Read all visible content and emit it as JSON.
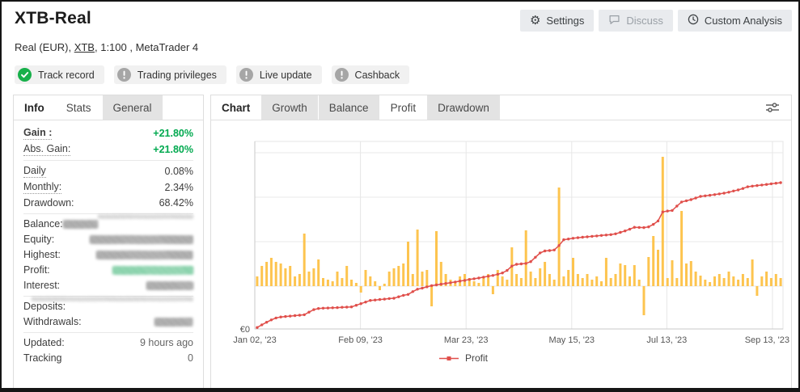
{
  "header": {
    "title": "XTB-Real",
    "subtitle": {
      "prefix": "Real (EUR), ",
      "link": "XTB",
      "suffix": ", 1:100 , MetaTrader 4"
    },
    "buttons": [
      {
        "label": "Settings",
        "icon": "gear-icon",
        "disabled": false
      },
      {
        "label": "Discuss",
        "icon": "speech-bubble-icon",
        "disabled": true
      },
      {
        "label": "Custom Analysis",
        "icon": "clock-icon",
        "disabled": false
      }
    ]
  },
  "badges": [
    {
      "label": "Track record",
      "status": "verified",
      "icon": "check-icon"
    },
    {
      "label": "Trading privileges",
      "status": "unverified",
      "icon": "exclamation-icon"
    },
    {
      "label": "Live update",
      "status": "unverified",
      "icon": "exclamation-icon"
    },
    {
      "label": "Cashback",
      "status": "unverified",
      "icon": "exclamation-icon"
    }
  ],
  "colors": {
    "accent_green": "#00a94f",
    "badge_green": "#17b04a",
    "badge_gray": "#a6a6a6",
    "bar_yellow": "#fdc44f",
    "line_red": "#e04f4b"
  },
  "stats_panel": {
    "title_tab": "Info",
    "tabs": [
      {
        "label": "Stats",
        "active": true
      },
      {
        "label": "General",
        "active": false
      }
    ],
    "groups": [
      {
        "rows": [
          {
            "label": "Gain :",
            "value": "+21.80%",
            "value_style": "green",
            "label_style": "bold dotted"
          },
          {
            "label": "Abs. Gain:",
            "value": "+21.80%",
            "value_style": "green",
            "label_style": "dotted"
          }
        ]
      },
      {
        "rows": [
          {
            "label": "Daily",
            "value": "0.08%",
            "label_style": "dotted"
          },
          {
            "label": "Monthly:",
            "value": "2.34%",
            "label_style": "dotted"
          },
          {
            "label": "Drawdown:",
            "value": "68.42%"
          }
        ]
      },
      {
        "ghost_width": 118,
        "rows": [
          {
            "label": "Balance:",
            "hidden_value": true,
            "noise_width": 92
          },
          {
            "label": "Equity:",
            "hidden_value": true,
            "noise_width": 128
          },
          {
            "label": "Highest:",
            "hidden_value": true,
            "noise_width": 120
          },
          {
            "label": "Profit:",
            "hidden_value": true,
            "noise_width": 100,
            "noise_color": "green"
          },
          {
            "label": "Interest:",
            "hidden_value": true,
            "noise_width": 58
          }
        ]
      },
      {
        "ghost_width": 200,
        "rows": [
          {
            "label": "Deposits:",
            "hidden_value": true,
            "noise_width": 78
          },
          {
            "label": "Withdrawals:",
            "hidden_value": true,
            "noise_width": 48
          }
        ]
      },
      {
        "rows": [
          {
            "label": "Updated:",
            "value": "9 hours ago",
            "value_style": "muted"
          },
          {
            "label": "Tracking",
            "value": "0",
            "value_style": "muted"
          }
        ]
      }
    ]
  },
  "chart_panel": {
    "title_tab": "Chart",
    "tabs": [
      {
        "label": "Growth",
        "active": false
      },
      {
        "label": "Balance",
        "active": false
      },
      {
        "label": "Profit",
        "active": true
      },
      {
        "label": "Drawdown",
        "active": false
      }
    ]
  },
  "chart_data": {
    "type": "bar+line",
    "title": "Profit",
    "x_axis": {
      "ticks": [
        "Jan 02, '23",
        "Feb 09, '23",
        "Mar 23, '23",
        "May 15, '23",
        "Jul 13, '23",
        "Sep 13, '23"
      ],
      "tick_fractions": [
        0,
        0.2,
        0.4,
        0.6,
        0.78,
        0.98
      ]
    },
    "y_axis": {
      "zero_label": "€0",
      "scale": "relative 0-100 (axis values hidden)",
      "gridlines": 4
    },
    "legend": [
      {
        "label": "Profit",
        "color": "#e04f4b"
      }
    ],
    "legend_position": "bottom-center",
    "series": [
      {
        "name": "Profit",
        "type": "line",
        "color": "#e04f4b",
        "values": [
          1,
          2.8,
          4.6,
          6.2,
          7.5,
          8.2,
          8.5,
          8.8,
          9.1,
          9.4,
          9.7,
          11.5,
          13.2,
          14,
          14.2,
          14.3,
          14.5,
          14.6,
          14.8,
          14.9,
          15.1,
          16.2,
          17.3,
          18.4,
          19.5,
          19.8,
          20.1,
          20.4,
          20.8,
          21,
          22,
          23,
          23.6,
          25.5,
          27.2,
          27.9,
          28.8,
          29.6,
          30.1,
          30.6,
          31.1,
          31.6,
          32.1,
          32.7,
          33.2,
          33.8,
          34.3,
          34.8,
          35.4,
          36,
          36.6,
          37.4,
          38.3,
          40,
          43,
          44.2,
          44.5,
          44.8,
          46,
          49,
          52,
          53.3,
          53.6,
          54,
          57,
          61,
          61.5,
          62,
          62.4,
          62.7,
          63,
          63.3,
          63.6,
          63.9,
          64.2,
          64.5,
          65,
          66,
          67,
          68.2,
          69.5,
          69.4,
          69.3,
          69.8,
          71.5,
          73.8,
          80,
          80.6,
          81,
          84,
          86.8,
          87.6,
          88.4,
          89.5,
          90.6,
          91,
          91.4,
          91.8,
          92.3,
          92.8,
          93.5,
          94.3,
          95,
          96,
          97.2,
          97.6,
          98,
          98.4,
          98.8,
          99.2,
          99.6,
          100
        ]
      },
      {
        "name": "Periodic profit (bars, unlabeled)",
        "type": "bar",
        "color": "#fdc44f",
        "values": [
          12,
          25,
          30,
          35,
          30,
          28,
          22,
          25,
          12,
          15,
          65,
          18,
          22,
          33,
          10,
          8,
          6,
          18,
          10,
          25,
          8,
          4,
          -8,
          20,
          12,
          6,
          -5,
          3,
          18,
          22,
          25,
          28,
          55,
          15,
          70,
          18,
          20,
          -25,
          68,
          30,
          15,
          8,
          5,
          12,
          15,
          10,
          6,
          4,
          10,
          15,
          -10,
          20,
          12,
          8,
          48,
          15,
          10,
          69,
          18,
          10,
          22,
          30,
          15,
          8,
          122,
          12,
          20,
          35,
          15,
          10,
          15,
          8,
          12,
          6,
          35,
          10,
          15,
          28,
          26,
          12,
          26,
          8,
          -36,
          36,
          62,
          45,
          160,
          10,
          32,
          10,
          93,
          28,
          31,
          18,
          13,
          8,
          5,
          12,
          15,
          10,
          18,
          12,
          8,
          15,
          10,
          33,
          -12,
          12,
          18,
          10,
          15,
          10
        ]
      }
    ]
  }
}
